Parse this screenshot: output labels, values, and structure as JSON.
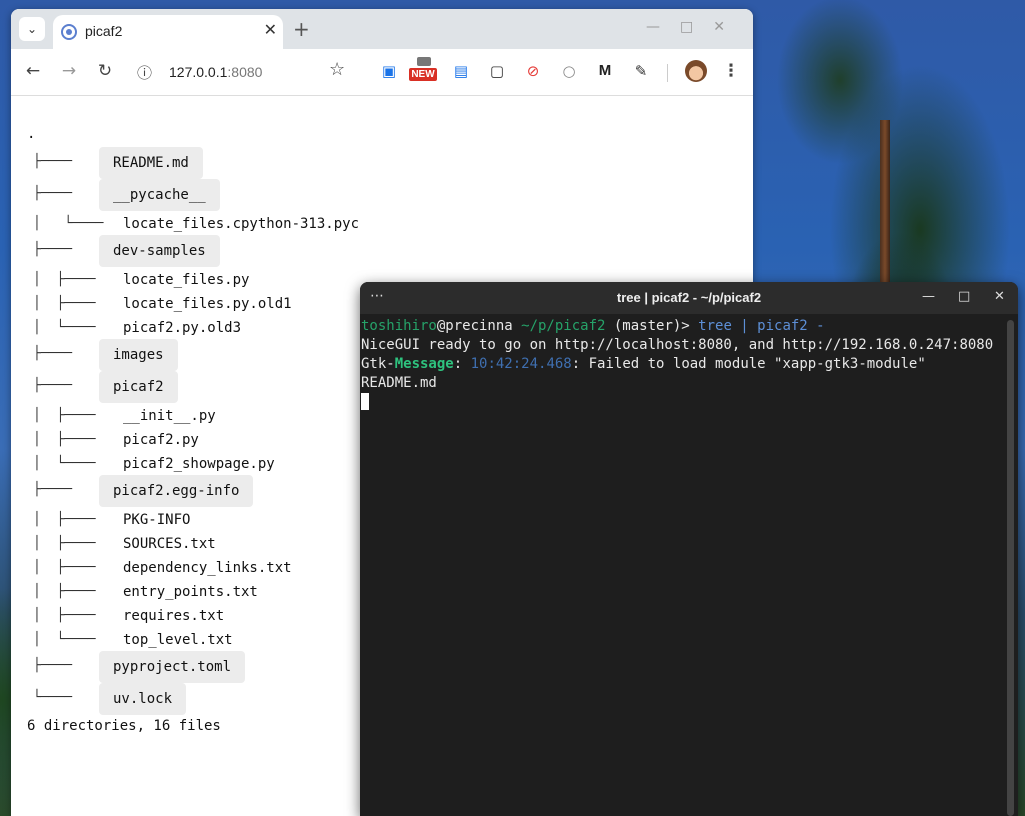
{
  "browser": {
    "tab_title": "picaf2",
    "url_host": "127.0.0.1",
    "url_port": ":8080",
    "new_badge": "NEW",
    "icons": [
      "tab-search-icon",
      "close-icon",
      "new-tab-icon",
      "back-icon",
      "forward-icon",
      "reload-icon",
      "site-info-icon",
      "bookmark-star-icon",
      "screenshot-extension-icon",
      "new-extension-icon",
      "chart-extension-icon",
      "capture-extension-icon",
      "block-extension-icon",
      "chat-extension-icon",
      "gmail-extension-icon",
      "extensions-puzzle-icon",
      "profile-avatar",
      "more-menu-icon"
    ]
  },
  "tree": {
    "root": ".",
    "rows": [
      {
        "prefix": "├────",
        "name": "README.md",
        "chip": true
      },
      {
        "prefix": "├────",
        "name": "__pycache__",
        "chip": true
      },
      {
        "prefix": "│   └────",
        "name": "locate_files.cpython-313.pyc",
        "chip": false
      },
      {
        "prefix": "├────",
        "name": "dev-samples",
        "chip": true
      },
      {
        "prefix": "│  ├────",
        "name": "locate_files.py",
        "chip": false
      },
      {
        "prefix": "│  ├────",
        "name": "locate_files.py.old1",
        "chip": false
      },
      {
        "prefix": "│  └────",
        "name": "picaf2.py.old3",
        "chip": false
      },
      {
        "prefix": "├────",
        "name": "images",
        "chip": true
      },
      {
        "prefix": "├────",
        "name": "picaf2",
        "chip": true
      },
      {
        "prefix": "│  ├────",
        "name": "__init__.py",
        "chip": false
      },
      {
        "prefix": "│  ├────",
        "name": "picaf2.py",
        "chip": false
      },
      {
        "prefix": "│  └────",
        "name": "picaf2_showpage.py",
        "chip": false
      },
      {
        "prefix": "├────",
        "name": "picaf2.egg-info",
        "chip": true
      },
      {
        "prefix": "│  ├────",
        "name": "PKG-INFO",
        "chip": false
      },
      {
        "prefix": "│  ├────",
        "name": "SOURCES.txt",
        "chip": false
      },
      {
        "prefix": "│  ├────",
        "name": "dependency_links.txt",
        "chip": false
      },
      {
        "prefix": "│  ├────",
        "name": "entry_points.txt",
        "chip": false
      },
      {
        "prefix": "│  ├────",
        "name": "requires.txt",
        "chip": false
      },
      {
        "prefix": "│  └────",
        "name": "top_level.txt",
        "chip": false
      },
      {
        "prefix": "├────",
        "name": "pyproject.toml",
        "chip": true
      },
      {
        "prefix": "└────",
        "name": "uv.lock",
        "chip": true
      }
    ],
    "summary": "6 directories, 16 files"
  },
  "terminal": {
    "title": "tree | picaf2 - ~/p/picaf2",
    "prompt_user": "toshihiro",
    "prompt_host": "@precinna",
    "prompt_path": " ~/p/picaf2",
    "prompt_branch": " (master)> ",
    "prompt_cmd": "tree | picaf2 -",
    "line2": "NiceGUI ready to go on http://localhost:8080, and http://192.168.0.247:8080",
    "line3_prefix": "Gtk-",
    "line3_msg": "Message",
    "line3_colon": ": ",
    "line3_time": "10:42:24.468",
    "line3_rest": ": Failed to load module \"xapp-gtk3-module\"",
    "line4": "README.md"
  }
}
